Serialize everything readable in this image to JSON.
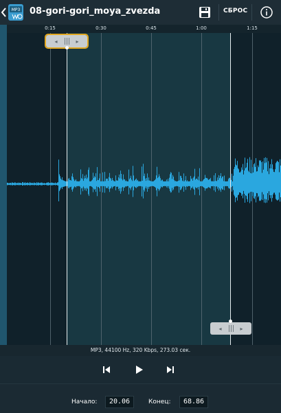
{
  "header": {
    "title": "08-gori-gori_moya_zvezda",
    "reset_label": "СБРОС"
  },
  "timeline": {
    "ticks": [
      "0:15",
      "0:30",
      "0:45",
      "1:00",
      "1:15"
    ]
  },
  "selection": {
    "start_seconds": 20.06,
    "end_seconds": 68.86
  },
  "file_info": "MP3, 44100 Hz, 320 Kbps, 273.03 сек.",
  "footer": {
    "start_label": "Начало:",
    "start_value": "20.06",
    "end_label": "Конец:",
    "end_value": "68.86"
  },
  "colors": {
    "accent": "#e2a71e",
    "wave": "#2aa7df",
    "background": "#1b2a33"
  },
  "icons": [
    "chevron-left-icon",
    "mp3-file-icon",
    "save-icon",
    "info-icon",
    "skip-back-icon",
    "play-icon",
    "skip-forward-icon"
  ]
}
